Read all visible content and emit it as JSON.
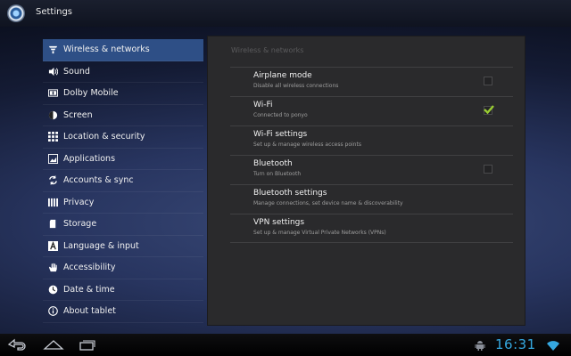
{
  "app": {
    "title": "Settings"
  },
  "sidebar": {
    "items": [
      {
        "label": "Wireless & networks",
        "icon": "wireless-icon",
        "selected": true
      },
      {
        "label": "Sound",
        "icon": "speaker-icon"
      },
      {
        "label": "Dolby Mobile",
        "icon": "dolby-icon"
      },
      {
        "label": "Screen",
        "icon": "brightness-icon"
      },
      {
        "label": "Location & security",
        "icon": "location-grid-icon"
      },
      {
        "label": "Applications",
        "icon": "applications-icon"
      },
      {
        "label": "Accounts & sync",
        "icon": "sync-icon"
      },
      {
        "label": "Privacy",
        "icon": "privacy-icon"
      },
      {
        "label": "Storage",
        "icon": "storage-icon"
      },
      {
        "label": "Language & input",
        "icon": "language-icon"
      },
      {
        "label": "Accessibility",
        "icon": "hand-icon"
      },
      {
        "label": "Date & time",
        "icon": "clock-icon"
      },
      {
        "label": "About tablet",
        "icon": "info-icon"
      }
    ]
  },
  "panel": {
    "header": "Wireless & networks",
    "rows": [
      {
        "title": "Airplane mode",
        "subtitle": "Disable all wireless connections",
        "checkbox": true,
        "checked": false
      },
      {
        "title": "Wi-Fi",
        "subtitle": "Connected to ponyo",
        "checkbox": true,
        "checked": true
      },
      {
        "title": "Wi-Fi settings",
        "subtitle": "Set up & manage wireless access points",
        "checkbox": false
      },
      {
        "title": "Bluetooth",
        "subtitle": "Turn on Bluetooth",
        "checkbox": true,
        "checked": false
      },
      {
        "title": "Bluetooth settings",
        "subtitle": "Manage connections, set device name & discoverability",
        "checkbox": false
      },
      {
        "title": "VPN settings",
        "subtitle": "Set up & manage Virtual Private Networks (VPNs)",
        "checkbox": false
      }
    ]
  },
  "statusbar": {
    "time": "16:31"
  },
  "colors": {
    "accent": "#2e4f86",
    "clock": "#35a8e0",
    "check": "#9acd32"
  }
}
